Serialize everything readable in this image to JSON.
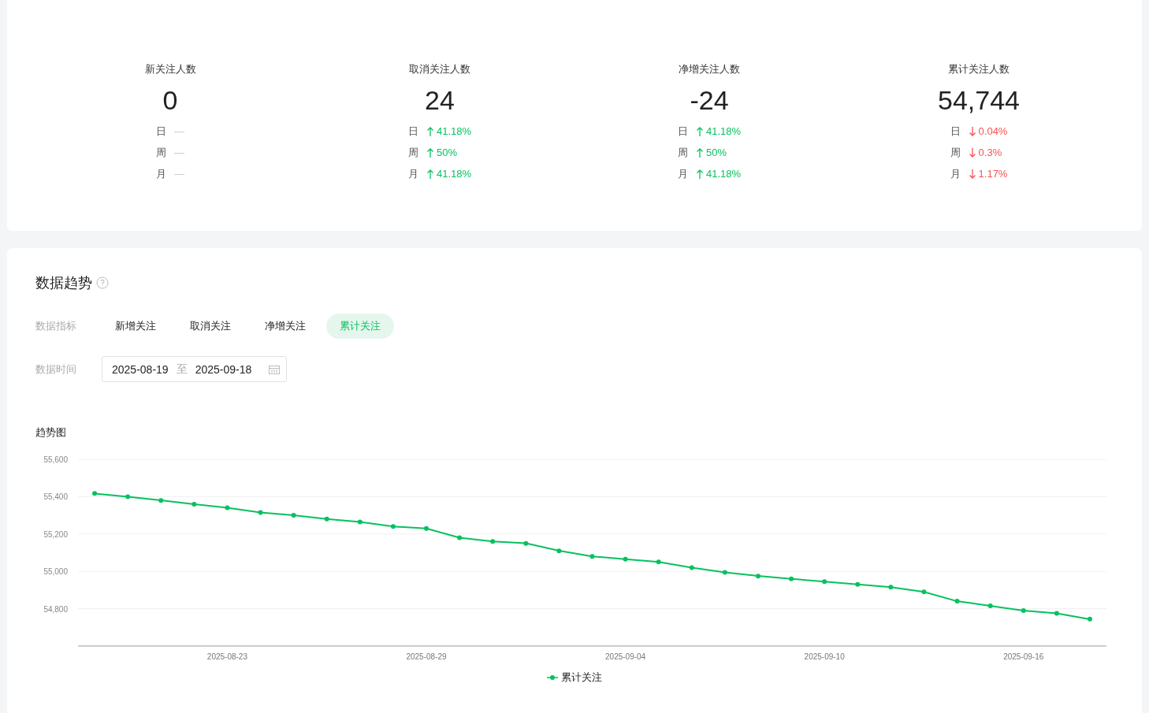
{
  "stats": [
    {
      "label": "新关注人数",
      "value": "0",
      "changes": [
        {
          "period": "日",
          "kind": "none",
          "value": "—"
        },
        {
          "period": "周",
          "kind": "none",
          "value": "—"
        },
        {
          "period": "月",
          "kind": "none",
          "value": "—"
        }
      ]
    },
    {
      "label": "取消关注人数",
      "value": "24",
      "changes": [
        {
          "period": "日",
          "kind": "up",
          "value": "41.18%"
        },
        {
          "period": "周",
          "kind": "up",
          "value": "50%"
        },
        {
          "period": "月",
          "kind": "up",
          "value": "41.18%"
        }
      ]
    },
    {
      "label": "净增关注人数",
      "value": "-24",
      "changes": [
        {
          "period": "日",
          "kind": "up",
          "value": "41.18%"
        },
        {
          "period": "周",
          "kind": "up",
          "value": "50%"
        },
        {
          "period": "月",
          "kind": "up",
          "value": "41.18%"
        }
      ]
    },
    {
      "label": "累计关注人数",
      "value": "54,744",
      "changes": [
        {
          "period": "日",
          "kind": "down",
          "value": "0.04%"
        },
        {
          "period": "周",
          "kind": "down",
          "value": "0.3%"
        },
        {
          "period": "月",
          "kind": "down",
          "value": "1.17%"
        }
      ]
    }
  ],
  "trend": {
    "title": "数据趋势",
    "metric_label": "数据指标",
    "metrics": [
      {
        "label": "新增关注",
        "selected": false
      },
      {
        "label": "取消关注",
        "selected": false
      },
      {
        "label": "净增关注",
        "selected": false
      },
      {
        "label": "累计关注",
        "selected": true
      }
    ],
    "date_label": "数据时间",
    "date_range": {
      "start": "2025-08-19",
      "separator": "至",
      "end": "2025-09-18"
    },
    "chart_title": "趋势图",
    "chart_data": {
      "type": "line",
      "grid": true,
      "categories": [
        null,
        null,
        null,
        null,
        "2025-08-23",
        null,
        null,
        null,
        null,
        null,
        "2025-08-29",
        null,
        null,
        null,
        null,
        null,
        "2025-09-04",
        null,
        null,
        null,
        null,
        null,
        "2025-09-10",
        null,
        null,
        null,
        null,
        null,
        "2025-09-16",
        null,
        null
      ],
      "series": [
        {
          "name": "累计关注",
          "color": "#07c160",
          "marker": "circle",
          "values": [
            55417,
            55400,
            55380,
            55360,
            55340,
            55315,
            55300,
            55280,
            55265,
            55240,
            55230,
            55180,
            55160,
            55150,
            55110,
            55080,
            55065,
            55050,
            55020,
            54995,
            54975,
            54960,
            54945,
            54930,
            54915,
            54890,
            54840,
            54815,
            54790,
            54775,
            54744
          ]
        }
      ],
      "ylim": [
        54600,
        55600
      ],
      "yticks": [
        {
          "value": 54800,
          "label": "54,800"
        },
        {
          "value": 55000,
          "label": "55,000"
        },
        {
          "value": 55200,
          "label": "55,200"
        },
        {
          "value": 55400,
          "label": "55,400"
        },
        {
          "value": 55600,
          "label": "55,600"
        }
      ]
    }
  }
}
